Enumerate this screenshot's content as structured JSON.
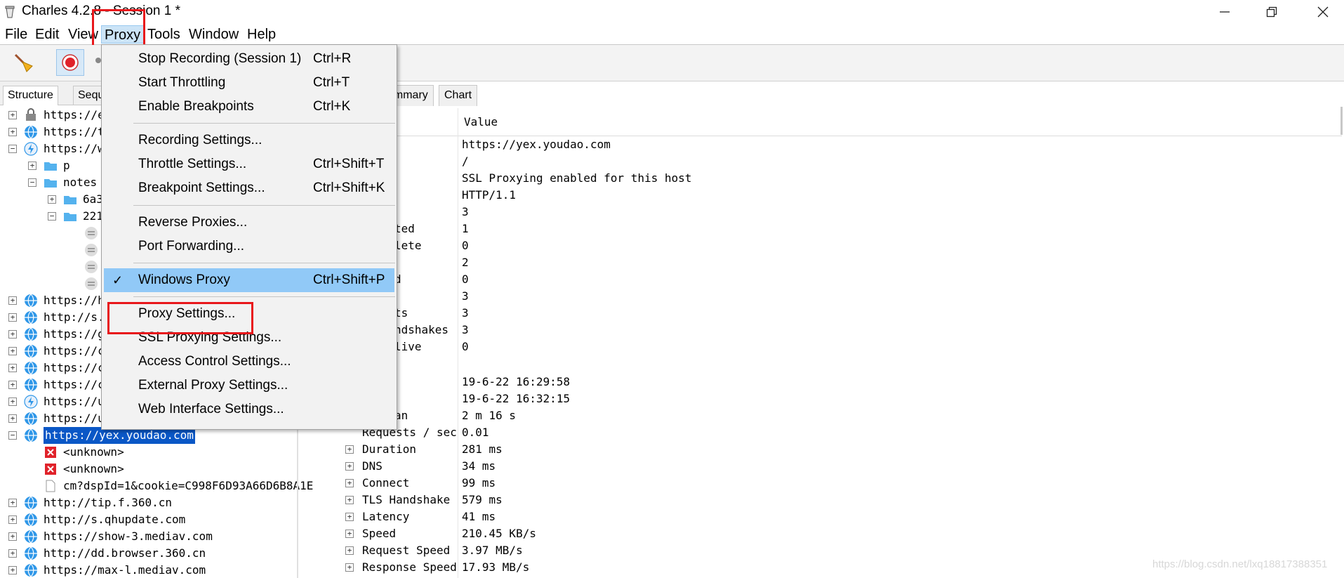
{
  "window": {
    "title": "Charles 4.2.8 - Session 1 *",
    "minimize_glyph": "—",
    "maximize_glyph": "❐",
    "close_glyph": "✕"
  },
  "menubar": {
    "items": [
      "File",
      "Edit",
      "View",
      "Proxy",
      "Tools",
      "Window",
      "Help"
    ],
    "active": "Proxy"
  },
  "proxy_menu": {
    "items": [
      {
        "label": "Stop Recording (Session 1)",
        "shortcut": "Ctrl+R"
      },
      {
        "label": "Start Throttling",
        "shortcut": "Ctrl+T"
      },
      {
        "label": "Enable Breakpoints",
        "shortcut": "Ctrl+K"
      },
      {
        "label": "Recording Settings...",
        "shortcut": ""
      },
      {
        "label": "Throttle Settings...",
        "shortcut": "Ctrl+Shift+T"
      },
      {
        "label": "Breakpoint Settings...",
        "shortcut": "Ctrl+Shift+K"
      },
      {
        "label": "Reverse Proxies...",
        "shortcut": ""
      },
      {
        "label": "Port Forwarding...",
        "shortcut": ""
      },
      {
        "label": "Windows Proxy",
        "shortcut": "Ctrl+Shift+P",
        "checked": true
      },
      {
        "label": "Proxy Settings...",
        "shortcut": ""
      },
      {
        "label": "SSL Proxying Settings...",
        "shortcut": ""
      },
      {
        "label": "Access Control Settings...",
        "shortcut": ""
      },
      {
        "label": "External Proxy Settings...",
        "shortcut": ""
      },
      {
        "label": "Web Interface Settings...",
        "shortcut": ""
      }
    ],
    "check_glyph": "✓"
  },
  "left_tabs": [
    "Structure",
    "Sequ"
  ],
  "tree": {
    "rows": [
      {
        "label": "https://e",
        "icon": "lock"
      },
      {
        "label": "https://t",
        "icon": "globe"
      },
      {
        "label": "https://w",
        "icon": "bolt"
      },
      {
        "label": "p",
        "icon": "folder"
      },
      {
        "label": "notes",
        "icon": "folder"
      },
      {
        "label": "6a3",
        "icon": "folder"
      },
      {
        "label": "221",
        "icon": "folder"
      },
      {
        "label": "https://h",
        "icon": "globe"
      },
      {
        "label": "http://s.",
        "icon": "globe"
      },
      {
        "label": "https://g",
        "icon": "globe"
      },
      {
        "label": "https://c",
        "icon": "globe"
      },
      {
        "label": "https://c",
        "icon": "globe"
      },
      {
        "label": "https://c",
        "icon": "globe"
      },
      {
        "label": "https://u",
        "icon": "bolt"
      },
      {
        "label": "https://u",
        "icon": "globe"
      },
      {
        "label": "https://yex.youdao.com",
        "icon": "globe"
      },
      {
        "label": "<unknown>",
        "icon": "error"
      },
      {
        "label": "<unknown>",
        "icon": "error"
      },
      {
        "label": "cm?dspId=1&cookie=C998F6D93A66D6B8A1E",
        "icon": "file"
      },
      {
        "label": "http://tip.f.360.cn",
        "icon": "globe"
      },
      {
        "label": "http://s.qhupdate.com",
        "icon": "globe"
      },
      {
        "label": "https://show-3.mediav.com",
        "icon": "globe"
      },
      {
        "label": "http://dd.browser.360.cn",
        "icon": "globe"
      },
      {
        "label": "https://max-l.mediav.com",
        "icon": "globe"
      }
    ]
  },
  "right_tabs": [
    "ummary",
    "Chart"
  ],
  "table": {
    "value_header": "Value",
    "rows": [
      {
        "key": "",
        "value": "https://yex.youdao.com"
      },
      {
        "key": "",
        "value": "/"
      },
      {
        "key": "",
        "value": "SSL Proxying enabled for this host"
      },
      {
        "key": "",
        "value": "HTTP/1.1"
      },
      {
        "key": "",
        "value": "3"
      },
      {
        "key": "ted",
        "value": "1"
      },
      {
        "key": "lete",
        "value": "0"
      },
      {
        "key": "",
        "value": "2"
      },
      {
        "key": "d",
        "value": "0"
      },
      {
        "key": "",
        "value": "3"
      },
      {
        "key": "ts",
        "value": "3"
      },
      {
        "key": "ndshakes",
        "value": "3"
      },
      {
        "key": "live",
        "value": "0"
      },
      {
        "key": "",
        "value": ""
      },
      {
        "key": "",
        "value": "19-6-22 16:29:58"
      },
      {
        "key": "",
        "value": "19-6-22 16:32:15"
      },
      {
        "key": "an",
        "value": "2 m 16 s"
      },
      {
        "key": "Requests / sec",
        "value": "0.01"
      },
      {
        "key": "Duration",
        "value": "281 ms",
        "expandable": true
      },
      {
        "key": "DNS",
        "value": "34 ms",
        "expandable": true
      },
      {
        "key": "Connect",
        "value": "99 ms",
        "expandable": true
      },
      {
        "key": "TLS Handshake",
        "value": "579 ms",
        "expandable": true
      },
      {
        "key": "Latency",
        "value": "41 ms",
        "expandable": true
      },
      {
        "key": "Speed",
        "value": "210.45 KB/s",
        "expandable": true
      },
      {
        "key": "Request Speed",
        "value": "3.97 MB/s",
        "expandable": true
      },
      {
        "key": "Response Speed",
        "value": "17.93 MB/s",
        "expandable": true
      }
    ]
  },
  "watermark": "https://blog.csdn.net/lxq18817388351",
  "colors": {
    "highlight": "#91c9f7",
    "selected_row": "#0a57c6",
    "annotation_red": "#e8171b"
  }
}
